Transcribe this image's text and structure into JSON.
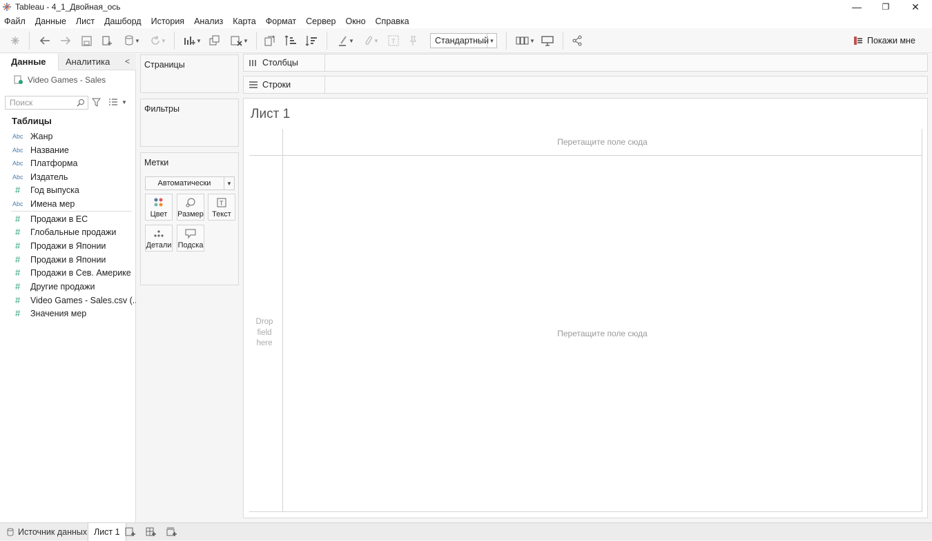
{
  "window": {
    "title": "Tableau - 4_1_Двойная_ось",
    "controls": [
      "—",
      "❐",
      "✕"
    ]
  },
  "menu": [
    "Файл",
    "Данные",
    "Лист",
    "Дашборд",
    "История",
    "Анализ",
    "Карта",
    "Формат",
    "Сервер",
    "Окно",
    "Справка"
  ],
  "toolbar": {
    "fit_value": "Стандартный",
    "show_me_label": "Покажи мне"
  },
  "left_pane": {
    "tab_data": "Данные",
    "tab_analytics": "Аналитика",
    "collapse": "<",
    "data_source": "Video Games - Sales",
    "search_placeholder": "Поиск",
    "tables_header": "Таблицы",
    "dimensions": [
      {
        "icon": "Abc",
        "label": "Жанр"
      },
      {
        "icon": "Abc",
        "label": "Название"
      },
      {
        "icon": "Abc",
        "label": "Платформа"
      },
      {
        "icon": "Abc",
        "label": "Издатель"
      },
      {
        "icon": "#",
        "label": "Год выпуска"
      },
      {
        "icon": "Abc",
        "label": "Имена мер"
      }
    ],
    "measures": [
      {
        "icon": "#",
        "label": "Продажи в ЕС"
      },
      {
        "icon": "#",
        "label": "Глобальные продажи"
      },
      {
        "icon": "#",
        "label": "Продажи в Японии"
      },
      {
        "icon": "#",
        "label": "Продажи в Японии"
      },
      {
        "icon": "#",
        "label": "Продажи в Сев. Америке"
      },
      {
        "icon": "#",
        "label": "Другие продажи"
      },
      {
        "icon": "#",
        "label": "Video Games - Sales.csv (..."
      },
      {
        "icon": "#",
        "label": "Значения мер"
      }
    ]
  },
  "cards": {
    "pages": "Страницы",
    "filters": "Фильтры",
    "marks": "Метки",
    "marks_type": "Автоматически",
    "mark_buttons": {
      "color": "Цвет",
      "size": "Размер",
      "text": "Текст",
      "detail": "Детали",
      "tooltip": "Подска"
    }
  },
  "shelves": {
    "columns": "Столбцы",
    "rows": "Строки"
  },
  "canvas": {
    "sheet_title": "Лист 1",
    "drop_top": "Перетащите поле сюда",
    "drop_center": "Перетащите поле сюда",
    "drop_left": "Drop field here"
  },
  "bottom_tabs": {
    "data_source": "Источник данных",
    "sheet": "Лист 1"
  }
}
